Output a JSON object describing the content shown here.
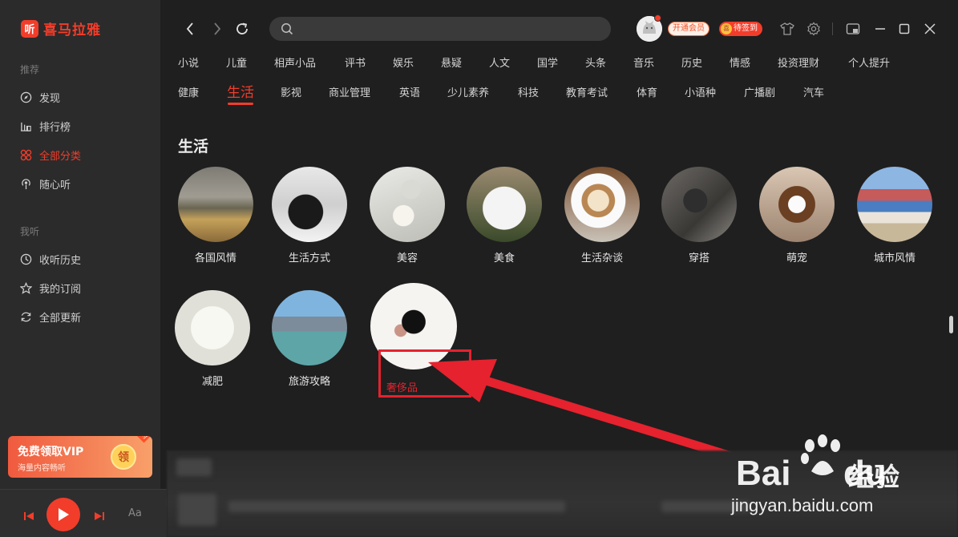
{
  "app": {
    "logo_badge": "听",
    "logo_text": "喜马拉雅"
  },
  "sidebar": {
    "section_recommend": "推荐",
    "items_top": [
      {
        "label": "发现",
        "icon": "compass-icon"
      },
      {
        "label": "排行榜",
        "icon": "bar-chart-icon"
      },
      {
        "label": "全部分类",
        "icon": "grid-icon",
        "active": true
      },
      {
        "label": "随心听",
        "icon": "podcast-icon"
      }
    ],
    "section_mine": "我听",
    "items_bottom": [
      {
        "label": "收听历史",
        "icon": "clock-icon"
      },
      {
        "label": "我的订阅",
        "icon": "star-icon"
      },
      {
        "label": "全部更新",
        "icon": "refresh-icon"
      }
    ],
    "vip_card": {
      "title": "免费领取VIP",
      "subtitle": "海量内容畅听",
      "coin": "领",
      "tag": "限时"
    }
  },
  "player": {
    "prev": "prev-icon",
    "play": "play-icon",
    "next": "next-icon",
    "font": "Aa"
  },
  "topbar": {
    "search_placeholder": "",
    "member_label": "开通会员",
    "sign_label": "待签到",
    "sign_coin": "喜"
  },
  "categories_row1": [
    "小说",
    "儿童",
    "相声小品",
    "评书",
    "娱乐",
    "悬疑",
    "人文",
    "国学",
    "头条",
    "音乐",
    "历史",
    "情感",
    "投资理财",
    "个人提升"
  ],
  "categories_row2": [
    "健康",
    "生活",
    "影视",
    "商业管理",
    "英语",
    "少儿素养",
    "科技",
    "教育考试",
    "体育",
    "小语种",
    "广播剧",
    "汽车"
  ],
  "active_category": "生活",
  "section_title": "生活",
  "subcategories": [
    "各国风情",
    "生活方式",
    "美容",
    "美食",
    "生活杂谈",
    "穿搭",
    "萌宠",
    "城市风情",
    "减肥",
    "旅游攻略",
    "奢侈品"
  ],
  "highlighted_label": "奢侈品",
  "colors": {
    "accent": "#f23d2b",
    "annotation": "#e5222e",
    "background": "#1f1f1f",
    "sidebar": "#2b2b2b"
  },
  "watermark": {
    "brand": "Bai",
    "brand2": "du",
    "product": "经验",
    "url": "jingyan.baidu.com"
  }
}
